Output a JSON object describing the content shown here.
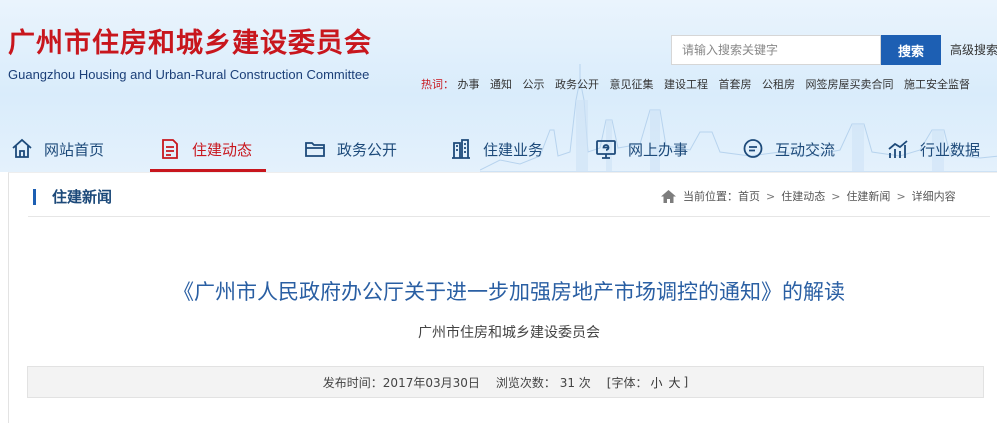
{
  "header": {
    "title_cn": "广州市住房和城乡建设委员会",
    "title_en": "Guangzhou Housing and Urban-Rural Construction Committee"
  },
  "search": {
    "placeholder": "请输入搜索关键字",
    "button_label": "搜索",
    "advanced_label": "高级搜索"
  },
  "hot": {
    "label": "热词：",
    "links": [
      "办事",
      "通知",
      "公示",
      "政务公开",
      "意见征集",
      "建设工程",
      "首套房",
      "公租房",
      "网签房屋买卖合同",
      "施工安全监督"
    ]
  },
  "nav": {
    "items": [
      {
        "label": "网站首页",
        "icon": "home-icon"
      },
      {
        "label": "住建动态",
        "icon": "document-icon",
        "active": true
      },
      {
        "label": "政务公开",
        "icon": "folder-icon"
      },
      {
        "label": "住建业务",
        "icon": "building-icon"
      },
      {
        "label": "网上办事",
        "icon": "online-service-icon"
      },
      {
        "label": "互动交流",
        "icon": "chat-icon"
      },
      {
        "label": "行业数据",
        "icon": "chart-icon"
      }
    ]
  },
  "section": {
    "title": "住建新闻"
  },
  "breadcrumb": {
    "prefix": "当前位置：",
    "items": [
      "首页",
      "住建动态",
      "住建新闻",
      "详细内容"
    ],
    "separator": ">"
  },
  "article": {
    "title": "《广州市人民政府办公厅关于进一步加强房地产市场调控的通知》的解读",
    "source": "广州市住房和城乡建设委员会",
    "meta": {
      "publish_label": "发布时间：2017年03月30日",
      "views_label": "浏览次数： 31 次",
      "font_label_open": "[字体：",
      "font_small": "小",
      "font_large": "大",
      "font_label_close": "]"
    }
  },
  "colors": {
    "brand_red": "#c8161d",
    "nav_blue": "#1d4a7a",
    "search_blue": "#1d5fb3",
    "link_blue": "#2a5fa3"
  }
}
